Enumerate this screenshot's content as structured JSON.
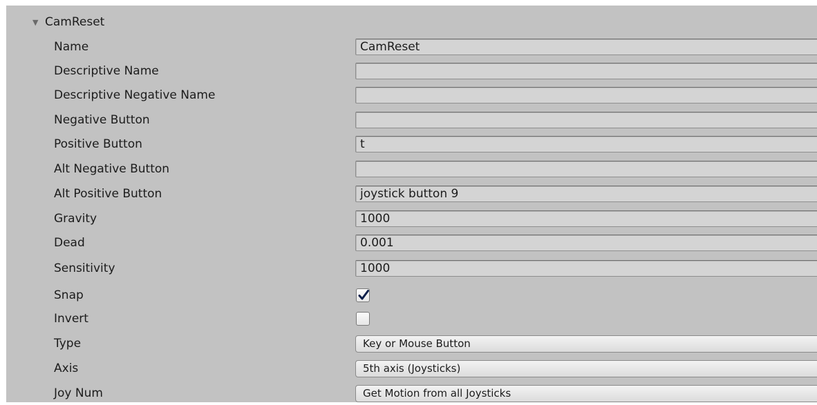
{
  "section": {
    "title": "CamReset",
    "expanded": true,
    "arrow_icon": "foldout-expanded-icon"
  },
  "fields": {
    "name": {
      "label": "Name",
      "value": "CamReset"
    },
    "descriptive_name": {
      "label": "Descriptive Name",
      "value": ""
    },
    "descriptive_negative_name": {
      "label": "Descriptive Negative Name",
      "value": ""
    },
    "negative_button": {
      "label": "Negative Button",
      "value": ""
    },
    "positive_button": {
      "label": "Positive Button",
      "value": "t"
    },
    "alt_negative_button": {
      "label": "Alt Negative Button",
      "value": ""
    },
    "alt_positive_button": {
      "label": "Alt Positive Button",
      "value": "joystick button 9"
    },
    "gravity": {
      "label": "Gravity",
      "value": "1000"
    },
    "dead": {
      "label": "Dead",
      "value": "0.001"
    },
    "sensitivity": {
      "label": "Sensitivity",
      "value": "1000"
    },
    "snap": {
      "label": "Snap",
      "checked": true
    },
    "invert": {
      "label": "Invert",
      "checked": false
    },
    "type": {
      "label": "Type",
      "selected": "Key or Mouse Button"
    },
    "axis": {
      "label": "Axis",
      "selected": "5th axis (Joysticks)"
    },
    "joy_num": {
      "label": "Joy Num",
      "selected": "Get Motion from all Joysticks"
    }
  },
  "colors": {
    "panel_background": "#c2c2c2",
    "field_background": "#d4d4d4",
    "text": "#1c1c1c",
    "checkmark": "#0c1f4a"
  }
}
